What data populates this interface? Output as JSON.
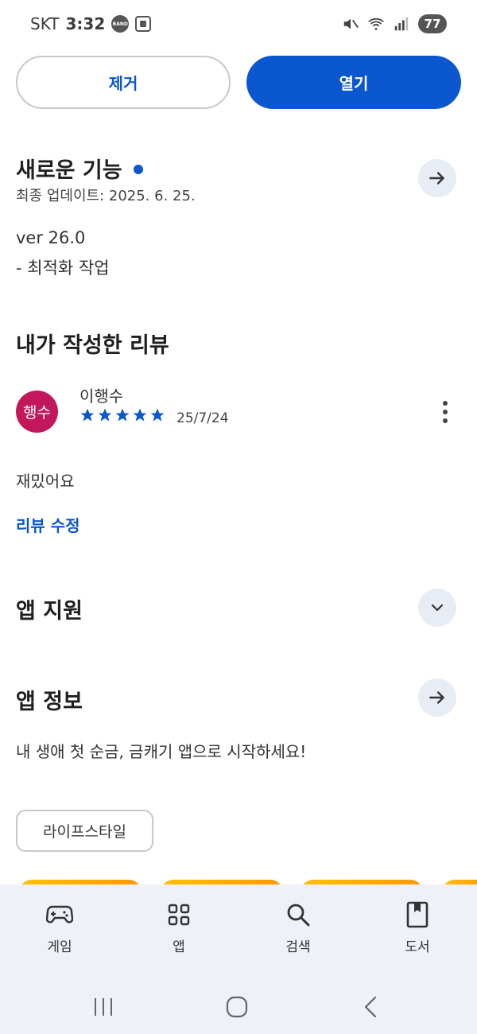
{
  "status_bar": {
    "carrier": "SKT",
    "time": "3:32",
    "band_label": "BAND",
    "battery": "77"
  },
  "actions": {
    "remove_label": "제거",
    "open_label": "열기"
  },
  "whats_new": {
    "title": "새로운 기능",
    "updated": "최종 업데이트: 2025. 6. 25.",
    "version": "ver 26.0",
    "changes": "- 최적화 작업"
  },
  "my_review": {
    "title": "내가 작성한 리뷰",
    "avatar_text": "행수",
    "reviewer": "이행수",
    "rating": 5,
    "date": "25/7/24",
    "text": "재밌어요",
    "edit_label": "리뷰 수정"
  },
  "app_support": {
    "title": "앱 지원"
  },
  "app_info": {
    "title": "앱 정보",
    "description": "내 생애 첫 순금, 금캐기 앱으로 시작하세요!",
    "category": "라이프스타일"
  },
  "bottom_nav": {
    "items": [
      {
        "label": "게임",
        "icon": "gamepad-icon"
      },
      {
        "label": "앱",
        "icon": "apps-grid-icon"
      },
      {
        "label": "검색",
        "icon": "search-icon"
      },
      {
        "label": "도서",
        "icon": "book-icon"
      }
    ]
  },
  "colors": {
    "accent": "#0b57d0",
    "avatar": "#c2185b",
    "nav_background": "#eef1f7"
  }
}
